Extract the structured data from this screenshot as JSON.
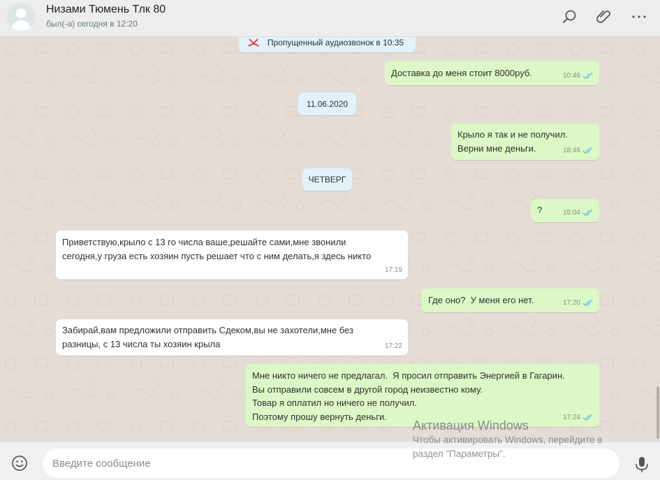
{
  "header": {
    "contact_name": "Низами Тюмень Тлк 80",
    "status": "был(-а) сегодня в 12:20",
    "icons": [
      "search-icon",
      "paperclip-icon",
      "more-icon"
    ]
  },
  "chat": {
    "missed_call": "Пропущенный аудиозвонок в 10:35",
    "date_1": "11.06.2020",
    "date_2": "ЧЕТВЕРГ",
    "messages": [
      {
        "dir": "out",
        "lines": [
          "Доставка до меня стоит 8000руб."
        ],
        "time": "10:46"
      },
      {
        "dir": "out",
        "lines": [
          "Крыло я так и не получил.",
          "Верни мне деньги."
        ],
        "time": "18:46"
      },
      {
        "dir": "out",
        "lines": [
          "?"
        ],
        "time": "15:04"
      },
      {
        "dir": "in",
        "lines": [
          "Приветствую,крыло с 13 го числа ваше,решайте сами,мне звонили",
          "сегодня,у груза есть хозяин пусть решает что с ним делать,я здесь никто"
        ],
        "time": "17:19"
      },
      {
        "dir": "out",
        "lines": [
          "Где оно?  У меня его нет."
        ],
        "time": "17:20"
      },
      {
        "dir": "in",
        "lines": [
          "Забирай,вам предложили отправить Сдеком,вы не захотели,мне без",
          "разницы, с 13 числа ты хозяин крыла"
        ],
        "time": "17:22"
      },
      {
        "dir": "out",
        "lines": [
          "Мне никто ничего не предлагал.  Я просил отправить Энергией в Гагарин.",
          "Вы отправили совсем в другой город неизвестно кому.",
          "Товар я оплатил но ничего не получил.",
          "Поэтому прошу вернуть деньги."
        ],
        "time": "17:24"
      }
    ]
  },
  "composer": {
    "placeholder": "Введите сообщение"
  },
  "watermark": {
    "title": "Активация Windows",
    "line1": "Чтобы активировать Windows, перейдите в",
    "line2": "раздел \"Параметры\"."
  },
  "colors": {
    "outgoing_bubble": "#dcf8c6",
    "incoming_bubble": "#ffffff",
    "system_bubble": "#e1f2fb",
    "chat_background": "#e5ddd5",
    "read_ticks": "#4fc3f7",
    "missed_call": "#e53935"
  }
}
